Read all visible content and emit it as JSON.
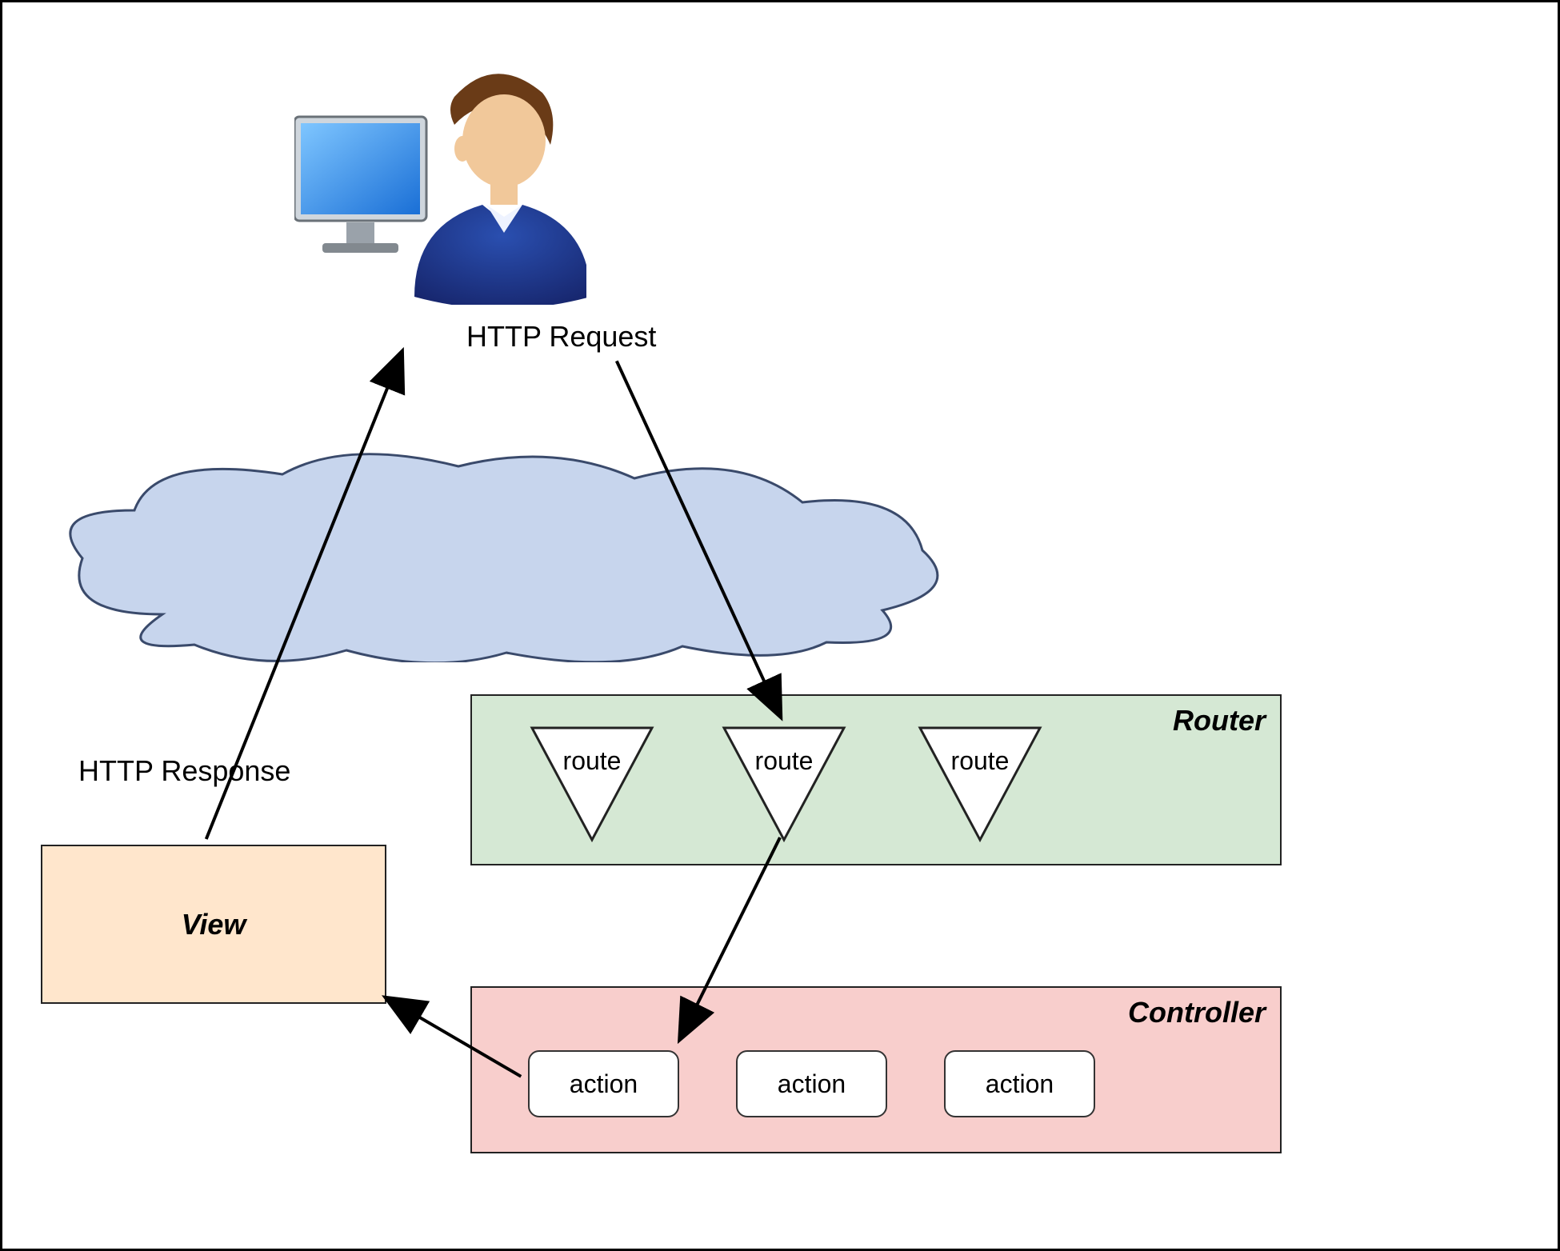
{
  "labels": {
    "http_request": "HTTP Request",
    "http_response": "HTTP Response"
  },
  "router": {
    "title": "Router",
    "routes": [
      "route",
      "route",
      "route"
    ]
  },
  "controller": {
    "title": "Controller",
    "actions": [
      "action",
      "action",
      "action"
    ]
  },
  "view": {
    "title": "View"
  },
  "colors": {
    "router_bg": "#d5e8d4",
    "controller_bg": "#f8cecc",
    "view_bg": "#ffe6cc",
    "cloud_fill": "#c7d5ed"
  }
}
